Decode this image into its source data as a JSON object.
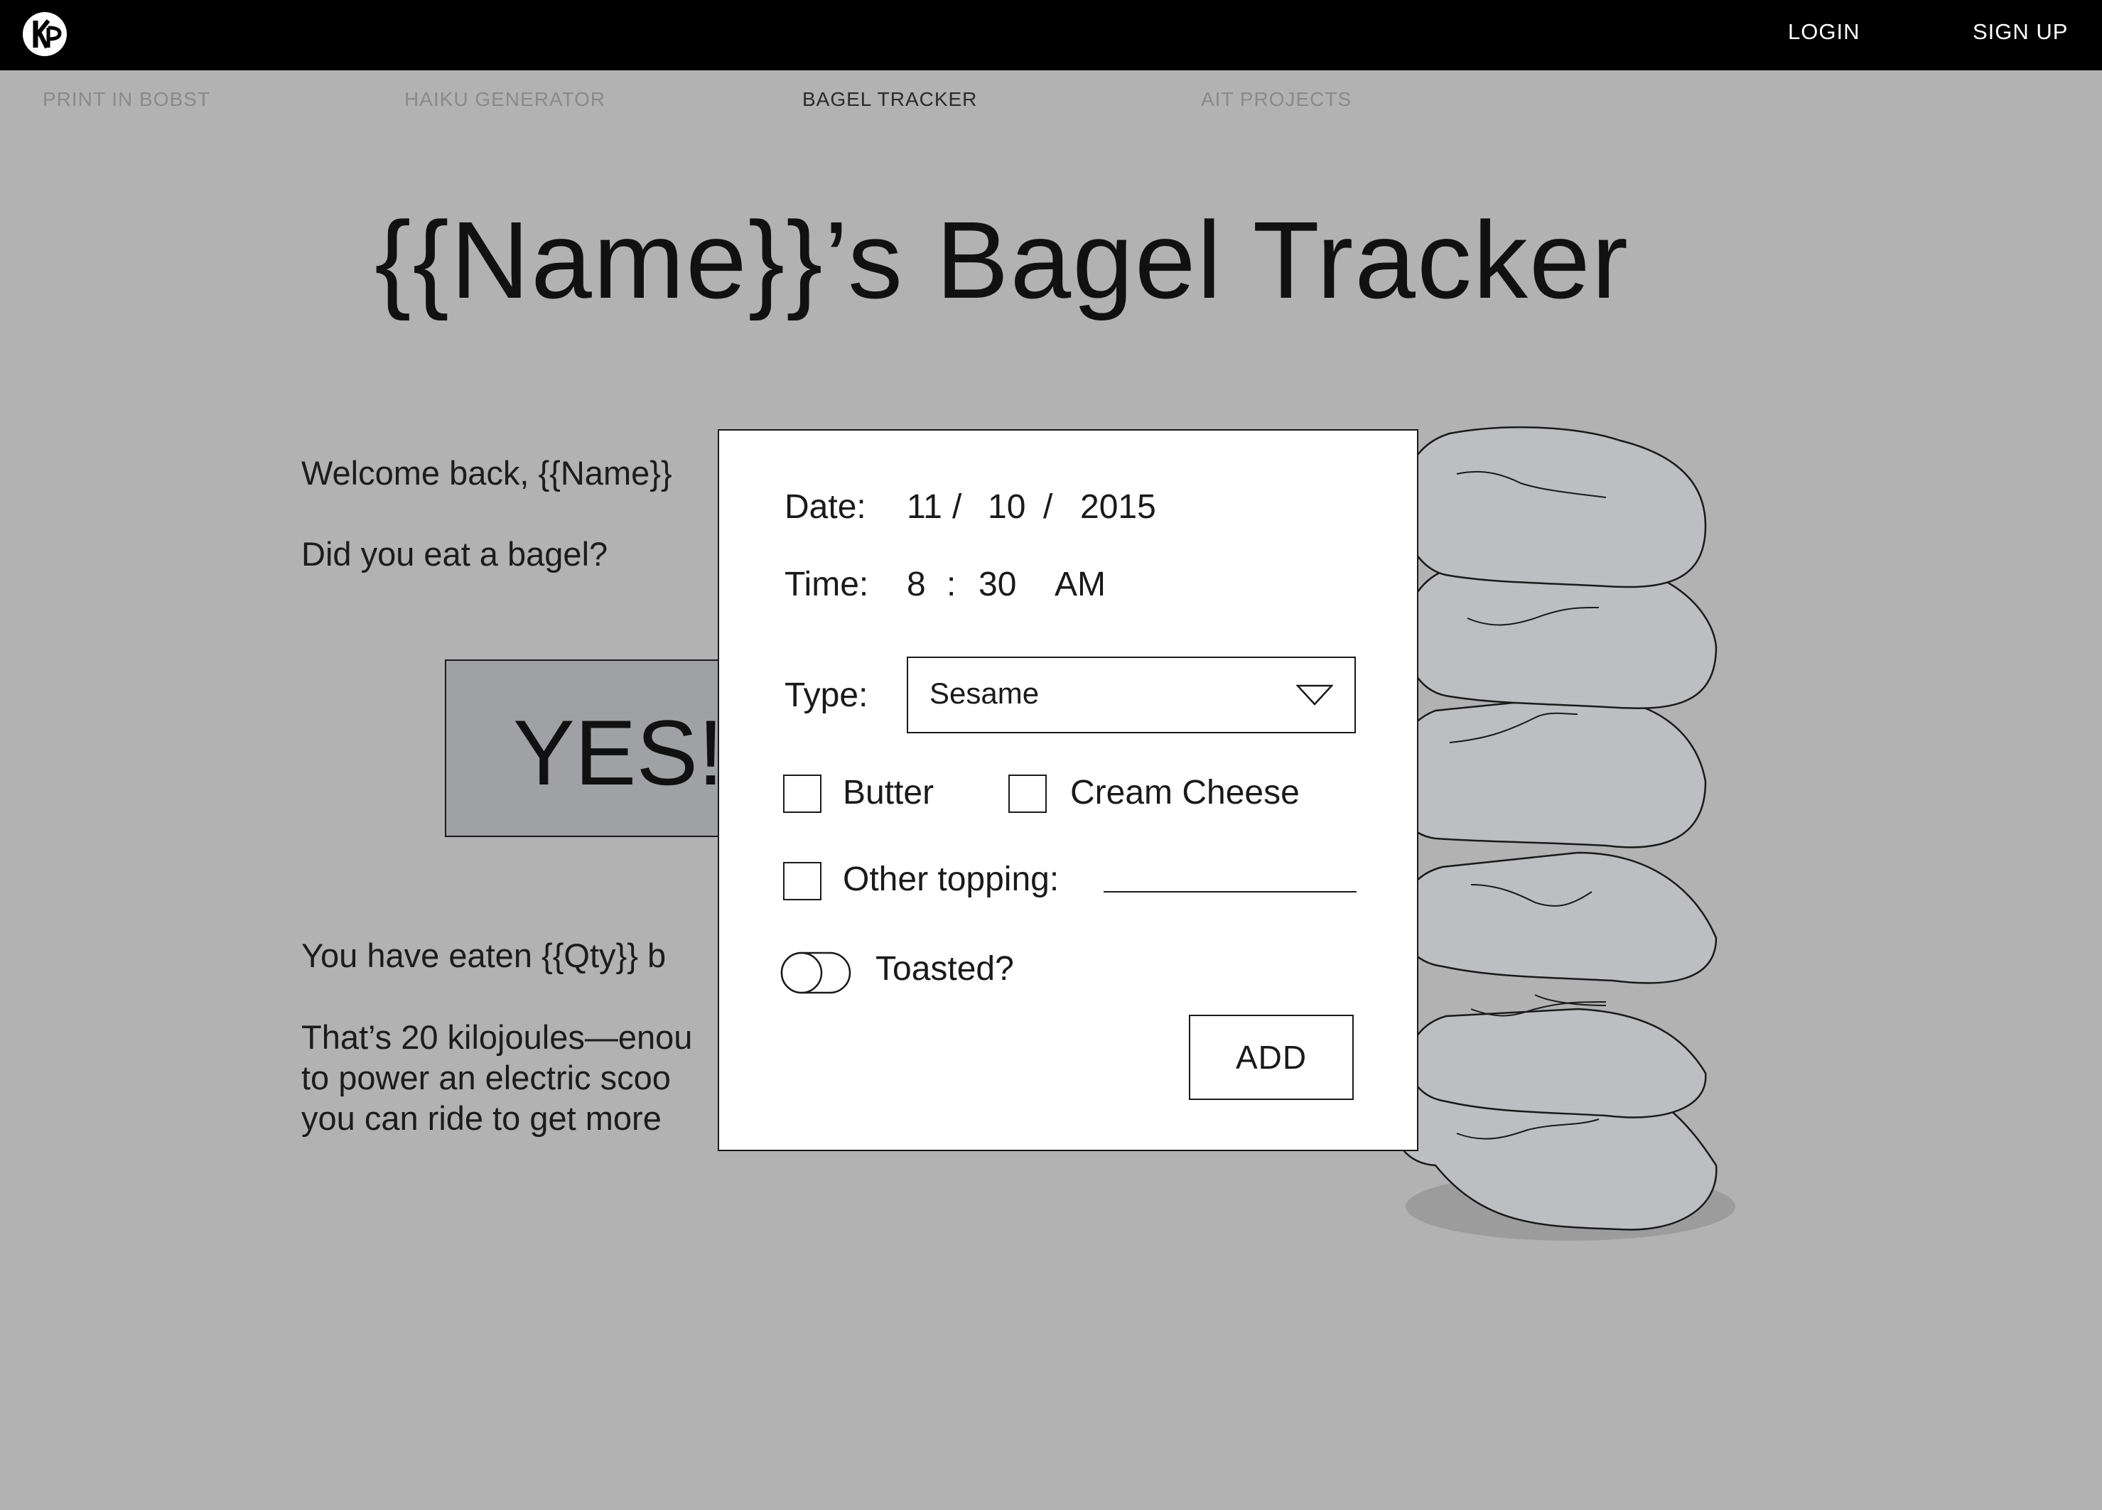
{
  "header": {
    "logo_letters": "KP",
    "login_label": "LOGIN",
    "signup_label": "SIGN UP"
  },
  "nav": {
    "items": [
      {
        "label": "PRINT IN BOBST",
        "active": false
      },
      {
        "label": "HAIKU GENERATOR",
        "active": false
      },
      {
        "label": "BAGEL TRACKER",
        "active": true
      },
      {
        "label": "AIT PROJECTS",
        "active": false
      }
    ]
  },
  "page": {
    "title": "{{Name}}’s Bagel Tracker",
    "welcome": "Welcome back, {{Name}}",
    "question": "Did you eat a bagel?",
    "yes_label": "YES!",
    "eaten_text": "You have eaten {{Qty}} b",
    "energy_lines": [
      "That’s 20 kilojoules—enou",
      "to power an electric scoo",
      "you can ride to get more"
    ]
  },
  "modal": {
    "date_label": "Date:",
    "date_month": "11",
    "date_day": "10",
    "date_year": "2015",
    "date_sep": "/",
    "time_label": "Time:",
    "time_hour": "8",
    "time_sep": ":",
    "time_minute": "30",
    "time_period": "AM",
    "type_label": "Type:",
    "type_value": "Sesame",
    "butter_label": "Butter",
    "cream_cheese_label": "Cream Cheese",
    "other_topping_label": "Other topping:",
    "toasted_label": "Toasted?",
    "add_label": "ADD"
  },
  "colors": {
    "background": "#b2b2b2",
    "topbar": "#000000",
    "yes_button": "#a0a1a4",
    "bagel_fill": "#bdbec2",
    "bagel_shadow": "#9c9c9c"
  }
}
